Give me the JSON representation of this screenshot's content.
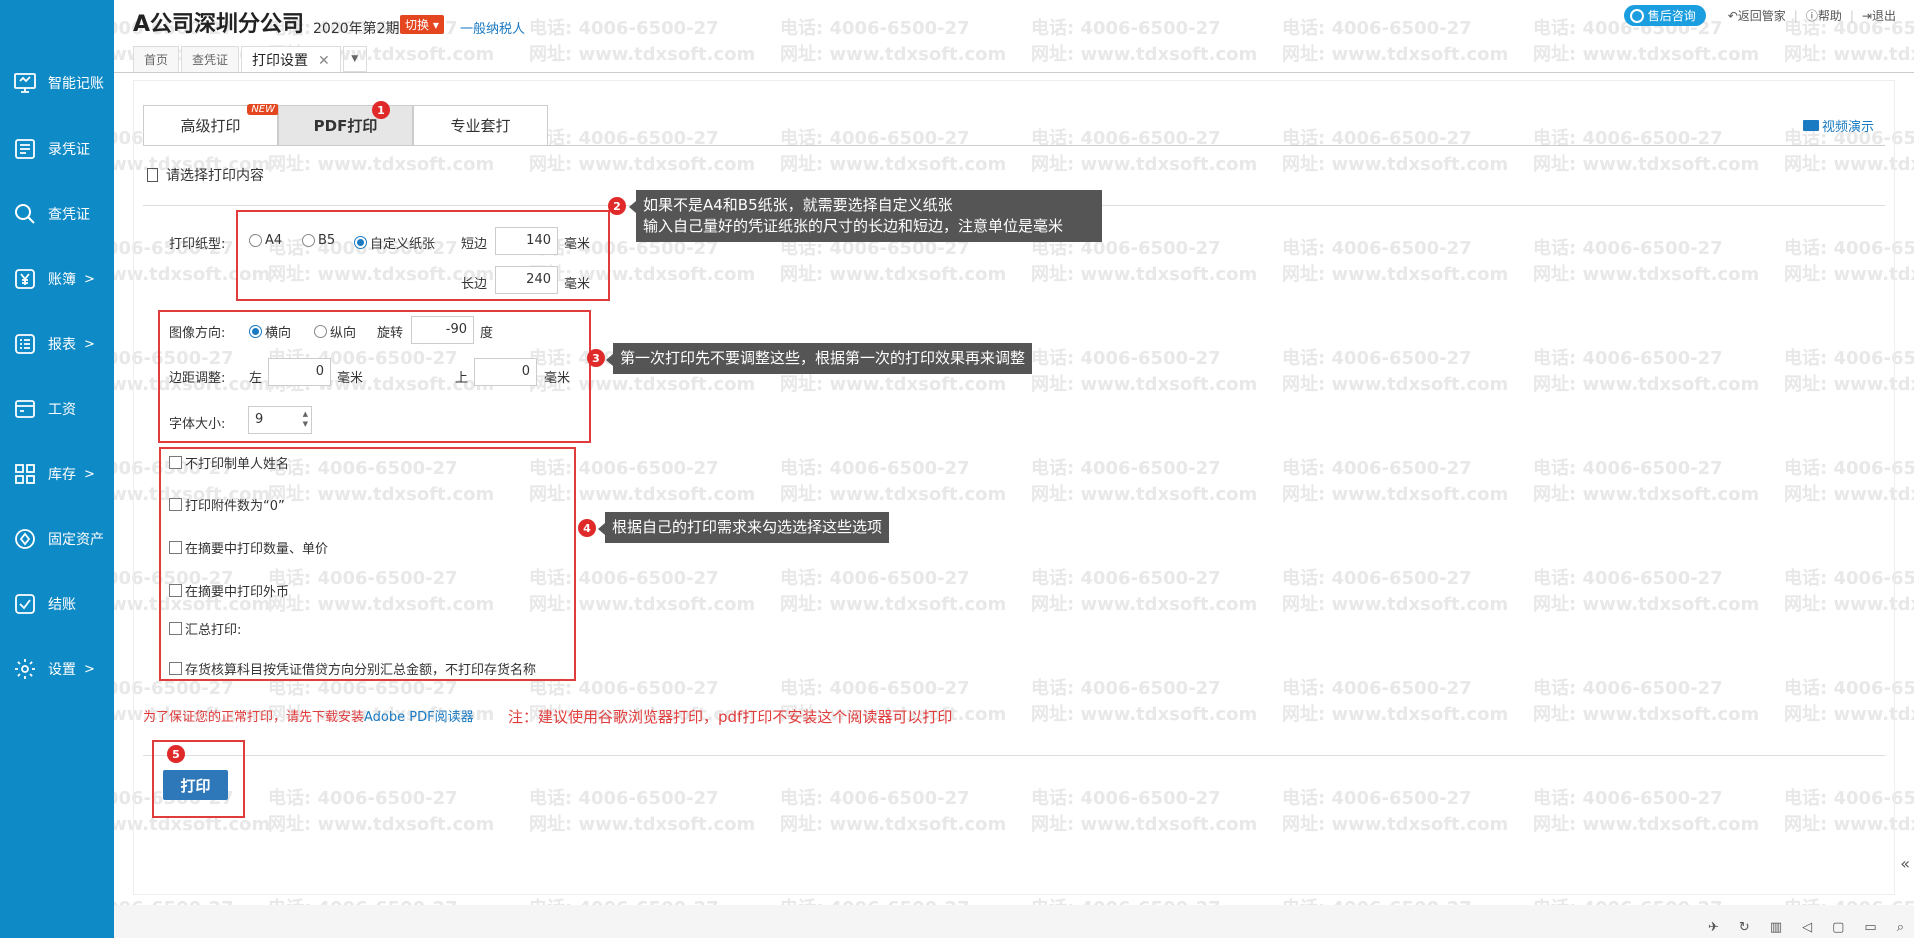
{
  "sidebar": {
    "items": [
      {
        "label": "智能记账",
        "icon": "monitor-icon",
        "arrow": ""
      },
      {
        "label": "录凭证",
        "icon": "voucher-entry-icon",
        "arrow": ""
      },
      {
        "label": "查凭证",
        "icon": "search-icon",
        "arrow": ""
      },
      {
        "label": "账簿",
        "icon": "yen-icon",
        "arrow": ">"
      },
      {
        "label": "报表",
        "icon": "report-icon",
        "arrow": ">"
      },
      {
        "label": "工资",
        "icon": "payroll-icon",
        "arrow": ""
      },
      {
        "label": "库存",
        "icon": "inventory-icon",
        "arrow": ">"
      },
      {
        "label": "固定资产",
        "icon": "asset-icon",
        "arrow": ""
      },
      {
        "label": "结账",
        "icon": "checkout-icon",
        "arrow": ""
      },
      {
        "label": "设置",
        "icon": "gear-icon",
        "arrow": ">"
      }
    ]
  },
  "header": {
    "company": "A公司深圳分公司",
    "period": "2020年第2期",
    "switch_label": "切换",
    "taxpayer": "一般纳税人",
    "service_label": "售后咨询",
    "back_label": "返回管家",
    "help_label": "帮助",
    "logout_label": "退出"
  },
  "tabs": [
    {
      "label": "首页"
    },
    {
      "label": "查凭证"
    },
    {
      "label": "打印设置"
    }
  ],
  "watermark": {
    "phone": "电话: 4006-6500-27",
    "web": "网址: www.tdxsoft.com"
  },
  "print_tabs": [
    {
      "label": "高级打印",
      "badge": "NEW"
    },
    {
      "label": "PDF打印"
    },
    {
      "label": "专业套打"
    }
  ],
  "video_demo": "视频演示",
  "section_title": "请选择打印内容",
  "paper": {
    "label": "打印纸型:",
    "options": [
      "A4",
      "B5",
      "自定义纸张"
    ],
    "selected": "自定义纸张",
    "short_label": "短边",
    "short_value": "140",
    "long_label": "长边",
    "long_value": "240",
    "unit": "毫米"
  },
  "orientation": {
    "label": "图像方向:",
    "options": [
      "横向",
      "纵向"
    ],
    "selected": "横向",
    "rotate_label": "旋转",
    "rotate_value": "-90",
    "rotate_unit": "度"
  },
  "margin": {
    "label": "边距调整:",
    "left_label": "左",
    "left_value": "0",
    "top_label": "上",
    "top_value": "0",
    "unit": "毫米"
  },
  "font_size": {
    "label": "字体大小:",
    "value": "9"
  },
  "options": [
    {
      "label": "不打印制单人姓名"
    },
    {
      "label": "打印附件数为“0”"
    },
    {
      "label": "在摘要中打印数量、单价"
    },
    {
      "label": "在摘要中打印外币"
    },
    {
      "label": "汇总打印:"
    },
    {
      "label": "存货核算科目按凭证借贷方向分别汇总金额，不打印存货名称"
    }
  ],
  "annotations": {
    "step1": "1",
    "step2": "2",
    "step3": "3",
    "step4": "4",
    "step5": "5",
    "tip2_line1": "如果不是A4和B5纸张，就需要选择自定义纸张",
    "tip2_line2": "输入自己量好的凭证纸张的尺寸的长边和短边，注意单位是毫米",
    "tip3": "第一次打印先不要调整这些，根据第一次的打印效果再来调整",
    "tip4": "根据自己的打印需求来勾选选择这些选项"
  },
  "warning": {
    "text": "为了保证您的正常打印，请先下载安装",
    "link": "Adobe PDF阅读器"
  },
  "note": "注：建议使用谷歌浏览器打印，pdf打印不安装这个阅读器可以打印",
  "print_button": "打印",
  "colors": {
    "sidebar": "#0e8ac6",
    "accent_red": "#e03c3c",
    "button_blue": "#2e77b8"
  }
}
